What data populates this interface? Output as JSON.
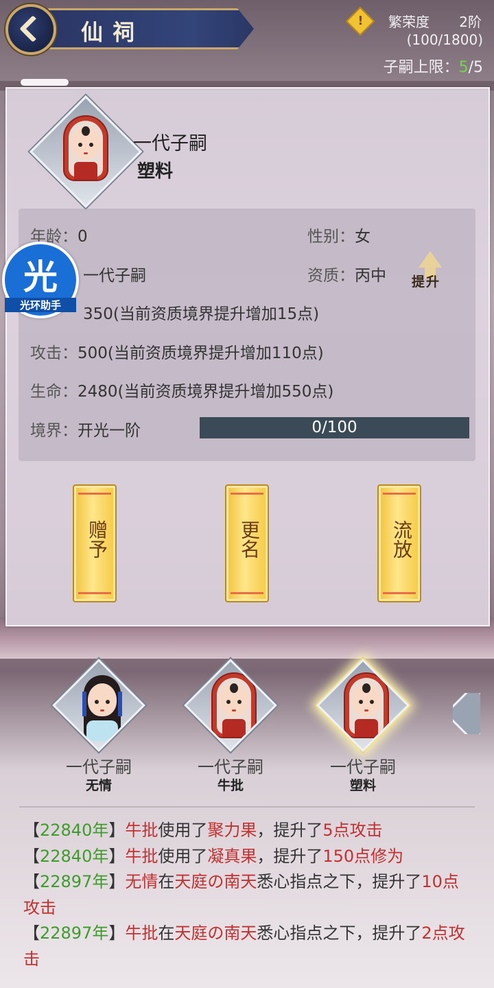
{
  "header": {
    "title": "仙祠",
    "prosperity_label": "繁荣度",
    "prosperity_level": "2阶",
    "prosperity_value": "(100/1800)",
    "limit_label": "子嗣上限：",
    "limit_current": "5",
    "limit_max": "/5"
  },
  "hero": {
    "name": "一代子嗣",
    "nickname": "塑料",
    "age_label": "年龄：",
    "age": "0",
    "gender_label": "性别：",
    "gender": "女",
    "generation": "一代子嗣",
    "quality_label": "资质：",
    "quality": "丙中",
    "upgrade_label": "提升",
    "cultivation_value": "350(当前资质境界提升增加15点)",
    "attack_label": "攻击：",
    "attack_value": "500(当前资质境界提升增加110点)",
    "hp_label": "生命：",
    "hp_value": "2480(当前资质境界提升增加550点)",
    "realm_label": "境界：",
    "realm": "开光一阶",
    "exp_text": "0/100",
    "exp_fraction": 0
  },
  "actions": {
    "gift": "赠予",
    "rename": "更名",
    "exile": "流放"
  },
  "badge": {
    "big": "光",
    "small": "光环助手"
  },
  "roster": [
    {
      "name": "一代子嗣",
      "sub": "无情"
    },
    {
      "name": "一代子嗣",
      "sub": "牛批"
    },
    {
      "name": "一代子嗣",
      "sub": "塑料"
    }
  ],
  "log": [
    {
      "year": "22840年",
      "who": "牛批",
      "p1": "使用了",
      "item": "聚力果",
      "p2": "，提升了",
      "gain": "5点攻击"
    },
    {
      "year": "22840年",
      "who": "牛批",
      "p1": "使用了",
      "item": "凝真果",
      "p2": "，提升了",
      "gain": "150点修为"
    },
    {
      "year": "22897年",
      "who": "无情",
      "p1": "在",
      "item": "天庭の南天",
      "p2": "悉心指点之下，提升了",
      "gain": "10点攻击"
    },
    {
      "year": "22897年",
      "who": "牛批",
      "p1": "在",
      "item": "天庭の南天",
      "p2": "悉心指点之下，提升了",
      "gain": "2点攻击"
    }
  ],
  "colors": {
    "accent_green": "#3e9c2a",
    "accent_red": "#c23030",
    "title_navy": "#2a3766",
    "scroll_gold": "#f0c33a"
  }
}
